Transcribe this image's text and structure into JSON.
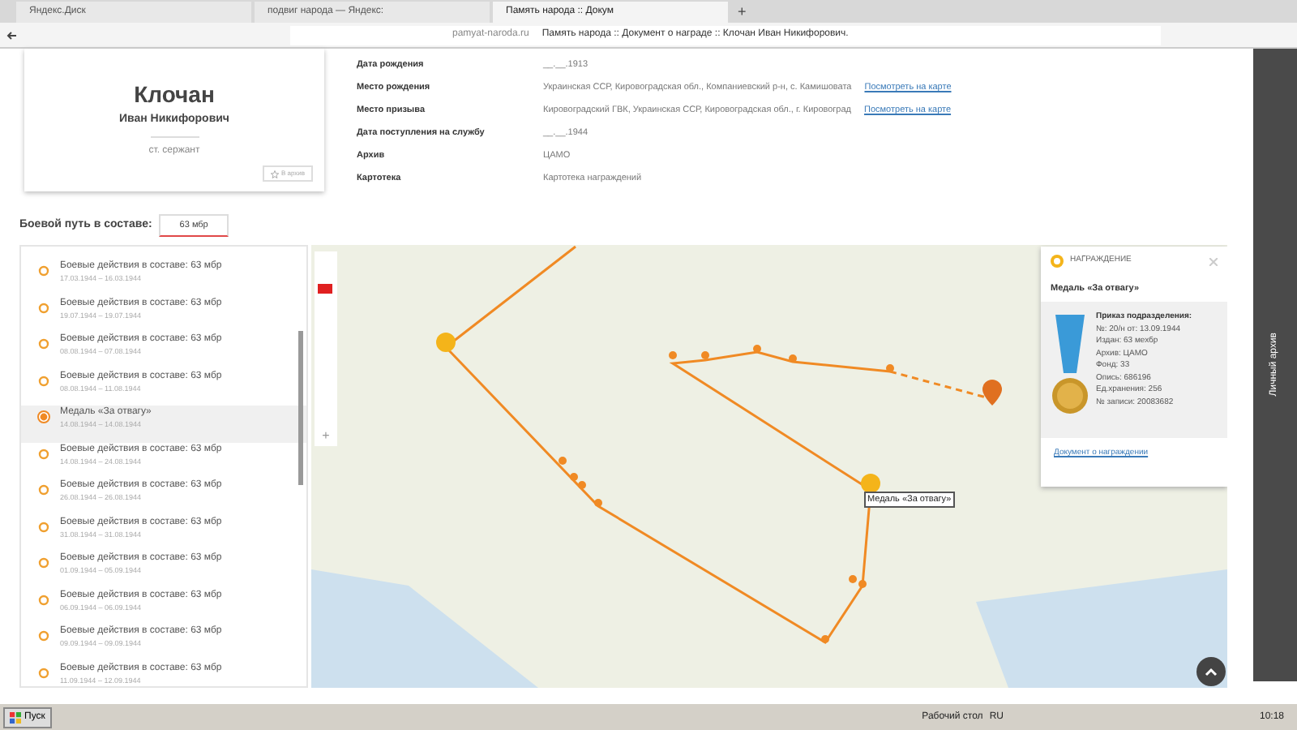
{
  "browser": {
    "tabs": [
      {
        "label": "Яндекс.Диск",
        "selected": false
      },
      {
        "label": "подвиг народа — Яндекс:",
        "selected": false
      },
      {
        "label": "Память народа :: Докум",
        "selected": true
      }
    ],
    "new_tab": "+",
    "address_host": "pamyat-naroda.ru",
    "address_title": "Память народа :: Документ о награде :: Клочан Иван Никифорович."
  },
  "profile": {
    "surname": "Клочан",
    "given_names": "Иван Никифорович",
    "rank": "ст. сержант",
    "archive_button": "В архив"
  },
  "info": [
    {
      "label": "Дата рождения",
      "value": "__.__.1913"
    },
    {
      "label": "Место рождения",
      "value": "Украинская ССР, Кировоградская обл., Компаниевский р-н, с. Камишовата",
      "link": "Посмотреть на карте"
    },
    {
      "label": "Место призыва",
      "value": "Кировоградский ГВК, Украинская ССР, Кировоградская обл., г. Кировоград",
      "link": "Посмотреть на карте"
    },
    {
      "label": "Дата поступления на службу",
      "value": "__.__.1944"
    },
    {
      "label": "Архив",
      "value": "ЦАМО"
    },
    {
      "label": "Картотека",
      "value": "Картотека награждений"
    }
  ],
  "combat_path": {
    "label": "Боевой путь в составе:",
    "unit": "63 мбр"
  },
  "events": [
    {
      "kind": "battle",
      "title": "Боевые действия в составе: 63 мбр",
      "dates": "17.03.1944 – 16.03.1944",
      "selected": false
    },
    {
      "kind": "battle",
      "title": "Боевые действия в составе: 63 мбр",
      "dates": "19.07.1944 – 19.07.1944",
      "selected": false
    },
    {
      "kind": "battle",
      "title": "Боевые действия в составе: 63 мбр",
      "dates": "08.08.1944 – 07.08.1944",
      "selected": false
    },
    {
      "kind": "battle",
      "title": "Боевые действия в составе: 63 мбр",
      "dates": "08.08.1944 – 11.08.1944",
      "selected": false
    },
    {
      "kind": "award",
      "title": "Медаль «За отвагу»",
      "dates": "14.08.1944 – 14.08.1944",
      "selected": true
    },
    {
      "kind": "battle",
      "title": "Боевые действия в составе: 63 мбр",
      "dates": "14.08.1944 – 24.08.1944",
      "selected": false
    },
    {
      "kind": "battle",
      "title": "Боевые действия в составе: 63 мбр",
      "dates": "26.08.1944 – 26.08.1944",
      "selected": false
    },
    {
      "kind": "battle",
      "title": "Боевые действия в составе: 63 мбр",
      "dates": "31.08.1944 – 31.08.1944",
      "selected": false
    },
    {
      "kind": "battle",
      "title": "Боевые действия в составе: 63 мбр",
      "dates": "01.09.1944 – 05.09.1944",
      "selected": false
    },
    {
      "kind": "battle",
      "title": "Боевые действия в составе: 63 мбр",
      "dates": "06.09.1944 – 06.09.1944",
      "selected": false
    },
    {
      "kind": "battle",
      "title": "Боевые действия в составе: 63 мбр",
      "dates": "09.09.1944 – 09.09.1944",
      "selected": false
    },
    {
      "kind": "battle",
      "title": "Боевые действия в составе: 63 мбр",
      "dates": "11.09.1944 – 12.09.1944",
      "selected": false
    }
  ],
  "map": {
    "zoom_in": "+",
    "tooltip": "Медаль «За отвагу»"
  },
  "award_panel": {
    "header": "НАГРАЖДЕНИЕ",
    "title": "Медаль «За отвагу»",
    "order_heading": "Приказ подразделения:",
    "details": [
      "№: 20/н от: 13.09.1944",
      "Издан: 63 мехбр",
      "Архив: ЦАМО",
      "Фонд: 33",
      "Опись: 686196",
      "Ед.хранения: 256",
      "№ записи: 20083682"
    ],
    "link": "Документ о награждении"
  },
  "side_tab": "Личный архив",
  "taskbar": {
    "start": "Пуск",
    "desktop": "Рабочий стол",
    "language": "RU",
    "clock": "10:18"
  }
}
